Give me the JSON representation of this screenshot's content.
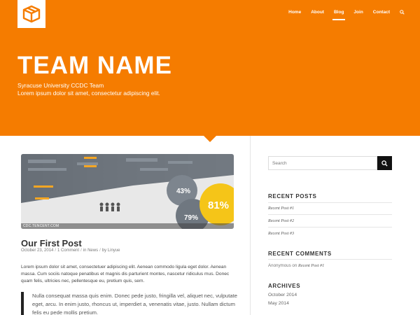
{
  "nav": {
    "items": [
      {
        "label": "Home"
      },
      {
        "label": "About"
      },
      {
        "label": "Blog",
        "active": true
      },
      {
        "label": "Join"
      },
      {
        "label": "Contact"
      }
    ]
  },
  "hero": {
    "title": "TEAM NAME",
    "subtitle_line1": "Syracuse University CCDC Team",
    "subtitle_line2": "Lorem ipsum dolor sit amet, consectetur adipiscing elit."
  },
  "post": {
    "image_caption": "CDC.TENCENT.COM",
    "title": "Our First Post",
    "date": "October 23, 2014",
    "comments": "1 Comment",
    "in_label": "in",
    "category": "News",
    "by_label": "by",
    "author": "Linyue",
    "body": "Lorem ipsum dolor sit amet, consectetuer adipiscing elit. Aenean commodo ligula eget dolor. Aenean massa. Cum sociis natoque penatibus et magnis dis parturient montes, nascetur ridiculus mus. Donec quam felis, ultricies nec, pellentesque eu, pretium quis, sem.",
    "quote": "Nulla consequat massa quis enim. Donec pede justo, fringilla vel, aliquet nec, vulputate eget, arcu. In enim justo, rhoncus ut, imperdiet a, venenatis vitae, justo. Nullam dictum felis eu pede mollis pretium."
  },
  "sidebar": {
    "search_placeholder": "Search",
    "recent_posts_title": "RECENT POSTS",
    "recent_posts": [
      "Recent Post #1",
      "Recent Post #2",
      "Recent Post #3"
    ],
    "recent_comments_title": "RECENT COMMENTS",
    "comment_author": "Anonymous",
    "comment_on": "on",
    "comment_post": "Recent Post #1",
    "archives_title": "ARCHIVES",
    "archives": [
      "October 2014",
      "May 2014"
    ]
  },
  "colors": {
    "brand": "#f57c00",
    "dark": "#111111"
  },
  "icons": {
    "logo": "box-icon",
    "search": "search-icon"
  }
}
